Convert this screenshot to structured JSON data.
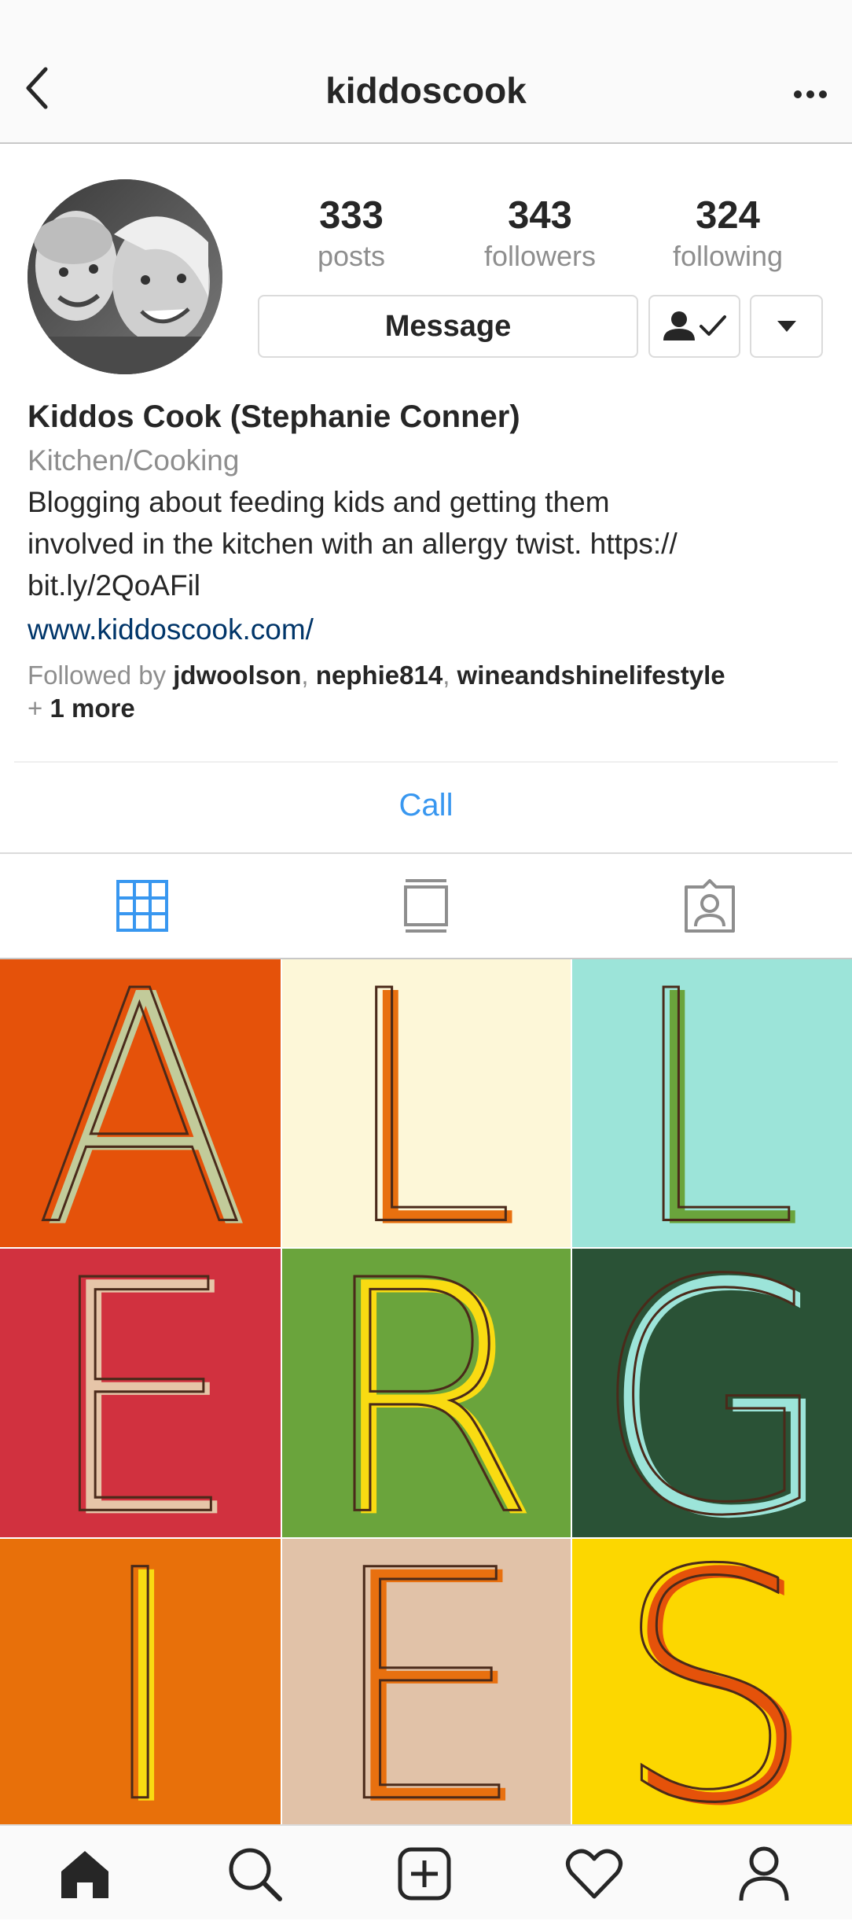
{
  "nav": {
    "username": "kiddoscook",
    "back_icon": "back-chevron-icon",
    "more_icon": "more-dots-icon"
  },
  "profile": {
    "stats": [
      {
        "value": "333",
        "label": "posts"
      },
      {
        "value": "343",
        "label": "followers"
      },
      {
        "value": "324",
        "label": "following"
      }
    ],
    "message_label": "Message",
    "follow_icon": "following-check-icon",
    "dropdown_icon": "dropdown-triangle-icon"
  },
  "bio": {
    "name": "Kiddos Cook (Stephanie Conner)",
    "category": "Kitchen/Cooking",
    "text_line1": "Blogging about feeding kids and getting them",
    "text_line2": "involved in the kitchen with an allergy twist. https://",
    "text_line3": "bit.ly/2QoAFil",
    "link": "www.kiddoscook.com/",
    "followed_prefix": "Followed by ",
    "followed_user1": "jdwoolson",
    "followed_user2": "nephie814",
    "followed_user3": "wineandshinelifestyle",
    "followed_sep": ", ",
    "followed_more_prefix": "+ ",
    "followed_more": "1 more"
  },
  "action": {
    "call_label": "Call"
  },
  "tabs": [
    {
      "icon": "grid-icon",
      "active": true
    },
    {
      "icon": "feed-list-icon",
      "active": false
    },
    {
      "icon": "tagged-photos-icon",
      "active": false
    }
  ],
  "posts": [
    {
      "letter": "A",
      "bg": "#e5520a",
      "fill": "#c2cb9a"
    },
    {
      "letter": "L",
      "bg": "#fdf7d8",
      "fill": "#e8700f"
    },
    {
      "letter": "L",
      "bg": "#9ce4d9",
      "fill": "#6aa43c"
    },
    {
      "letter": "E",
      "bg": "#d1313f",
      "fill": "#e6c5a8"
    },
    {
      "letter": "R",
      "bg": "#6aa43c",
      "fill": "#f9db12"
    },
    {
      "letter": "G",
      "bg": "#2a5236",
      "fill": "#9ce4d9"
    },
    {
      "letter": "I",
      "bg": "#e8700a",
      "fill": "#f9db12"
    },
    {
      "letter": "E",
      "bg": "#e1c2a8",
      "fill": "#e8700f"
    },
    {
      "letter": "S",
      "bg": "#fcd700",
      "fill": "#e5520a"
    }
  ],
  "bottom_nav": [
    {
      "icon": "home-icon"
    },
    {
      "icon": "search-icon"
    },
    {
      "icon": "new-post-icon"
    },
    {
      "icon": "activity-heart-icon"
    },
    {
      "icon": "profile-icon"
    }
  ]
}
